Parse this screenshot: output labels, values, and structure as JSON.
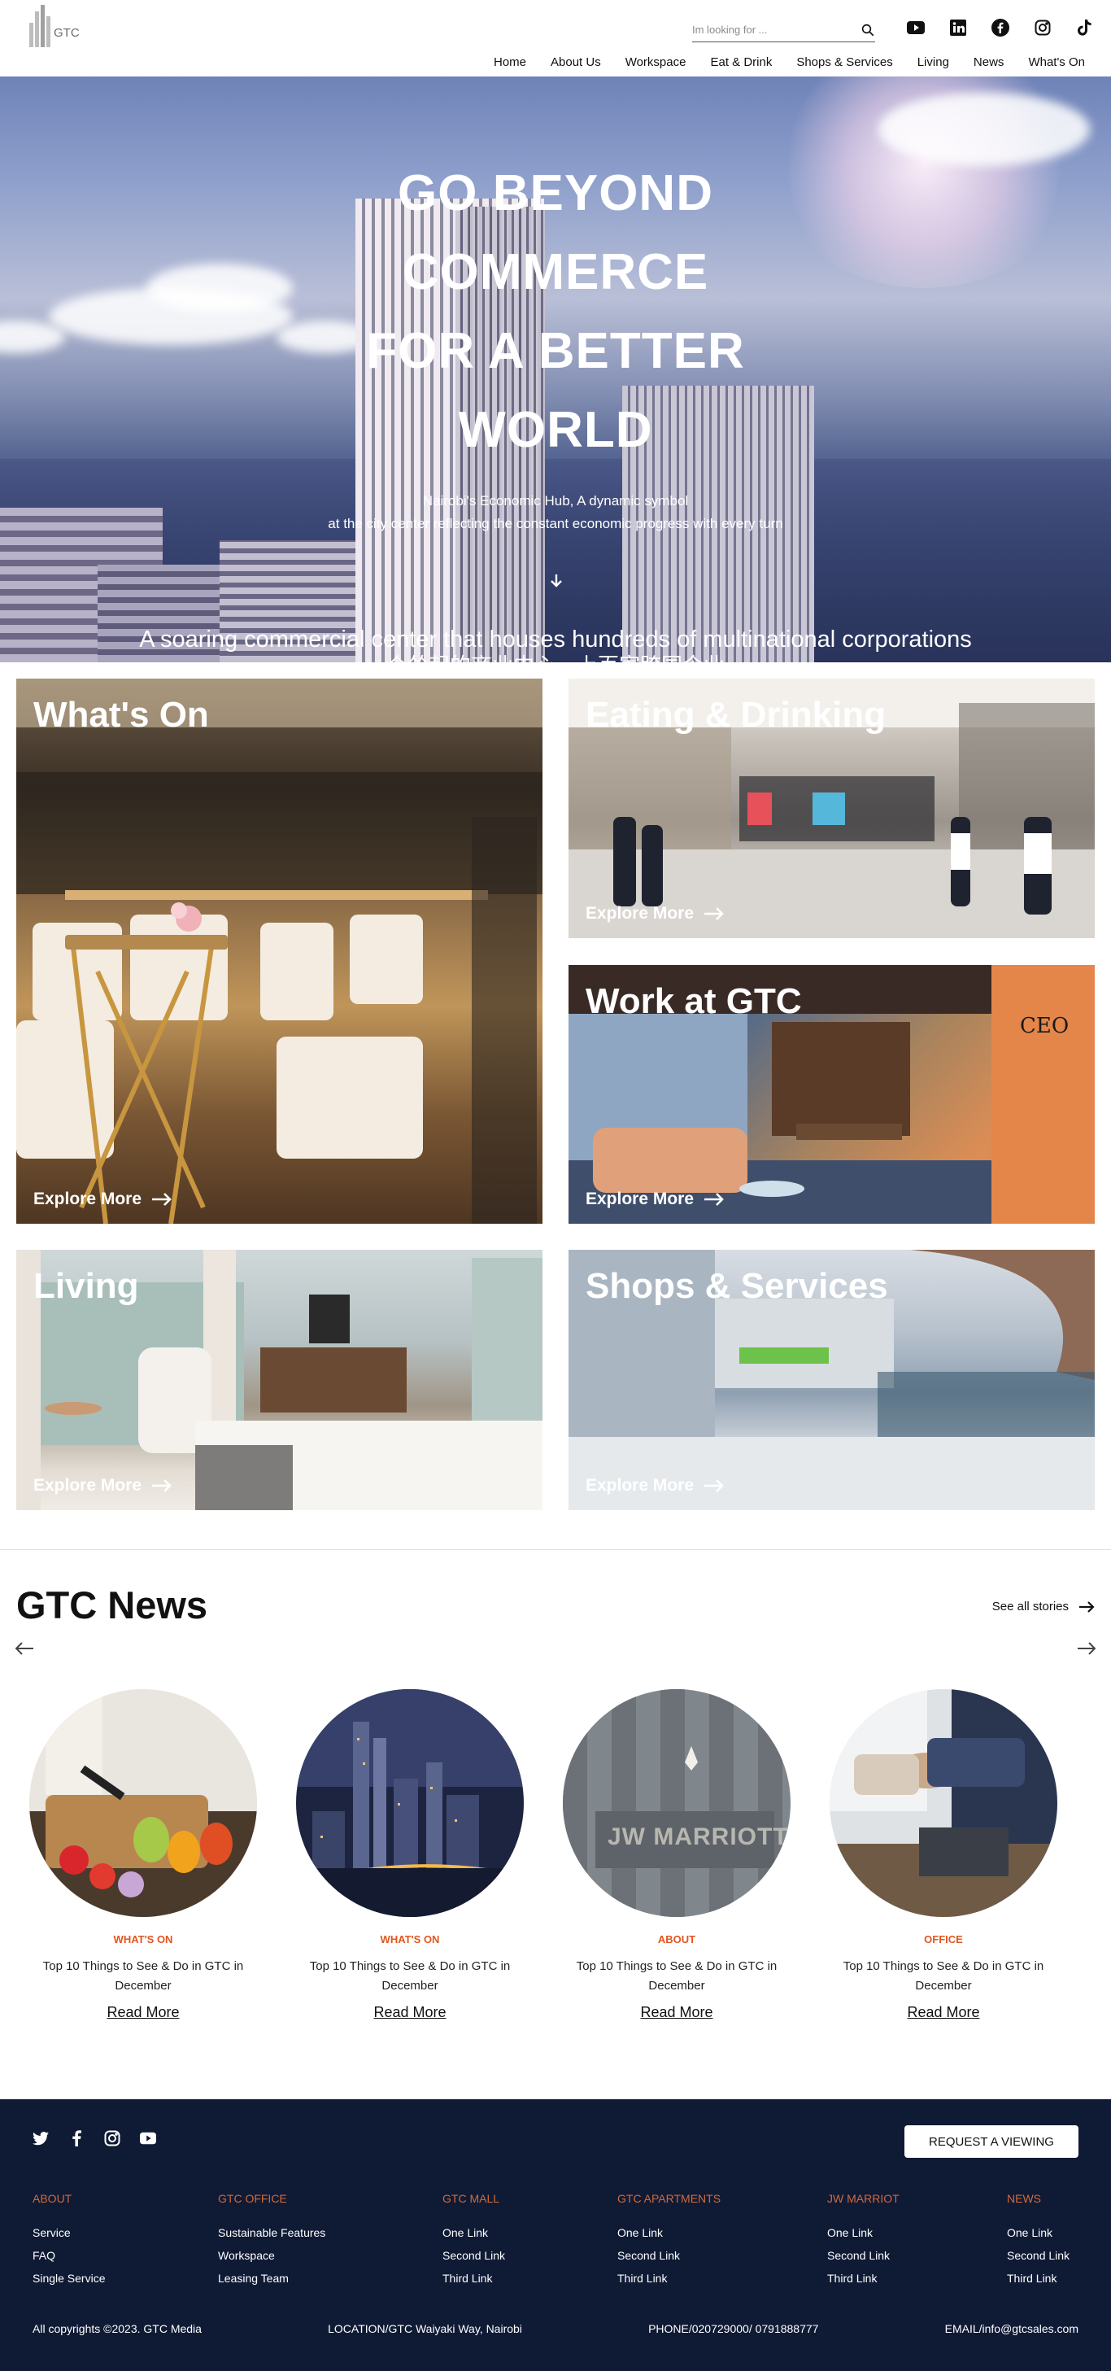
{
  "header": {
    "logo_text": "GTC",
    "search_placeholder": "Im looking for ...",
    "social": [
      "youtube-icon",
      "linkedin-icon",
      "facebook-icon",
      "instagram-icon",
      "tiktok-icon"
    ],
    "nav": [
      "Home",
      "About Us",
      "Workspace",
      "Eat & Drink",
      "Shops & Services",
      "Living",
      "News",
      "What's On"
    ]
  },
  "hero": {
    "title_lines": [
      "GO BEYOND",
      "COMMERCE",
      "FOR A BETTER",
      "WORLD"
    ],
    "subtitle_lines": [
      "Nairobi's Economic Hub, A dynamic symbol",
      "at the city center reflecting the constant economic progress with every turn"
    ],
    "caption": "A soaring commercial center that houses hundreds of multinational corporations",
    "caption_cn": "个耸起的商业中心，上百家跨国企业"
  },
  "cards": {
    "whatson": {
      "title": "What's On",
      "link": "Explore More"
    },
    "eat": {
      "title": "Eating & Drinking",
      "link": "Explore More"
    },
    "work": {
      "title": "Work at GTC",
      "link": "Explore More"
    },
    "living": {
      "title": "Living",
      "link": "Explore More"
    },
    "shops": {
      "title": "Shops & Services",
      "link": "Explore More"
    }
  },
  "news": {
    "title": "GTC News",
    "see_all": "See all stories",
    "items": [
      {
        "category": "WHAT'S ON",
        "title": "Top 10 Things to See & Do in GTC in December",
        "read_more": "Read More"
      },
      {
        "category": "WHAT'S ON",
        "title": "Top 10 Things to See & Do in GTC in December",
        "read_more": "Read More"
      },
      {
        "category": "ABOUT",
        "title": "Top 10 Things to See & Do in GTC in December",
        "read_more": "Read More"
      },
      {
        "category": "OFFICE",
        "title": "Top 10 Things to See & Do in GTC in December",
        "read_more": "Read More"
      }
    ]
  },
  "footer": {
    "social": [
      "twitter-icon",
      "facebook-icon",
      "instagram-icon",
      "youtube-icon"
    ],
    "request_button": "REQUEST A VIEWING",
    "columns": [
      {
        "heading": "ABOUT",
        "links": [
          "Service",
          "FAQ",
          "Single Service"
        ]
      },
      {
        "heading": "GTC OFFICE",
        "links": [
          "Sustainable Features",
          "Workspace",
          "Leasing Team"
        ]
      },
      {
        "heading": "GTC MALL",
        "links": [
          "One Link",
          "Second Link",
          "Third Link"
        ]
      },
      {
        "heading": "GTC APARTMENTS",
        "links": [
          "One Link",
          "Second Link",
          "Third Link"
        ]
      },
      {
        "heading": "JW MARRIOT",
        "links": [
          "One Link",
          "Second Link",
          "Third Link"
        ]
      },
      {
        "heading": "NEWS",
        "links": [
          "One Link",
          "Second Link",
          "Third Link"
        ]
      }
    ],
    "copyright": "All copyrights ©2023. GTC Media",
    "location": "LOCATION/GTC Waiyaki Way, Nairobi",
    "phone": "PHONE/020729000/ 0791888777",
    "email": "EMAIL/info@gtcsales.com"
  }
}
